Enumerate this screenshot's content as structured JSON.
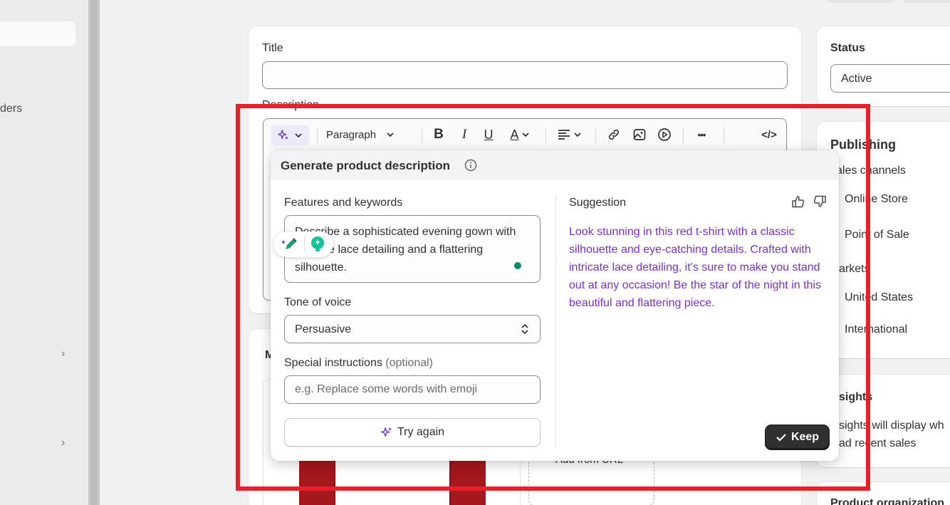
{
  "nav": {
    "orders_partial": "ders",
    "chevron": "›"
  },
  "product_card": {
    "title_label": "Title",
    "title_value": "",
    "description_label": "Description",
    "media_partial": "M",
    "add_from_url": "Add from URL"
  },
  "toolbar": {
    "paragraph": "Paragraph",
    "bold": "B",
    "italic": "I",
    "underline": "U",
    "text_color": "A",
    "more": "•••",
    "code": "</>"
  },
  "generate_popover": {
    "title": "Generate product description",
    "features_label": "Features and keywords",
    "features_value": "Describe a sophisticated evening gown with intricate lace detailing and a flattering silhouette.",
    "tone_label": "Tone of voice",
    "tone_value": "Persuasive",
    "instructions_label": "Special instructions",
    "instructions_optional": "(optional)",
    "instructions_placeholder": "e.g. Replace some words with emoji",
    "try_again": "Try again",
    "suggestion_label": "Suggestion",
    "suggestion_text": "Look stunning in this red t-shirt with a classic silhouette and eye-catching details. Crafted with intricate lace detailing, it's sure to make you stand out at any occasion! Be the star of the night in this beautiful and flattering piece.",
    "keep": "Keep"
  },
  "right_column": {
    "status_label": "Status",
    "status_value": "Active",
    "publishing_label": "Publishing",
    "sales_channels_partial": "ales channels",
    "online_store": "Online Store",
    "point_of_sale": "Point of Sale",
    "markets_partial": "arkets",
    "united_states": "United States",
    "international": "International",
    "insights_partial": "sights",
    "insights_text_1": "sights will display wh",
    "insights_text_2": "ad recent sales",
    "product_org_partial": "Product organization"
  },
  "colors": {
    "highlight": "#e8202a",
    "suggestion_text": "#7a2fd6",
    "keep_button": "#303030",
    "grammarly_green": "#0d8a6e"
  }
}
